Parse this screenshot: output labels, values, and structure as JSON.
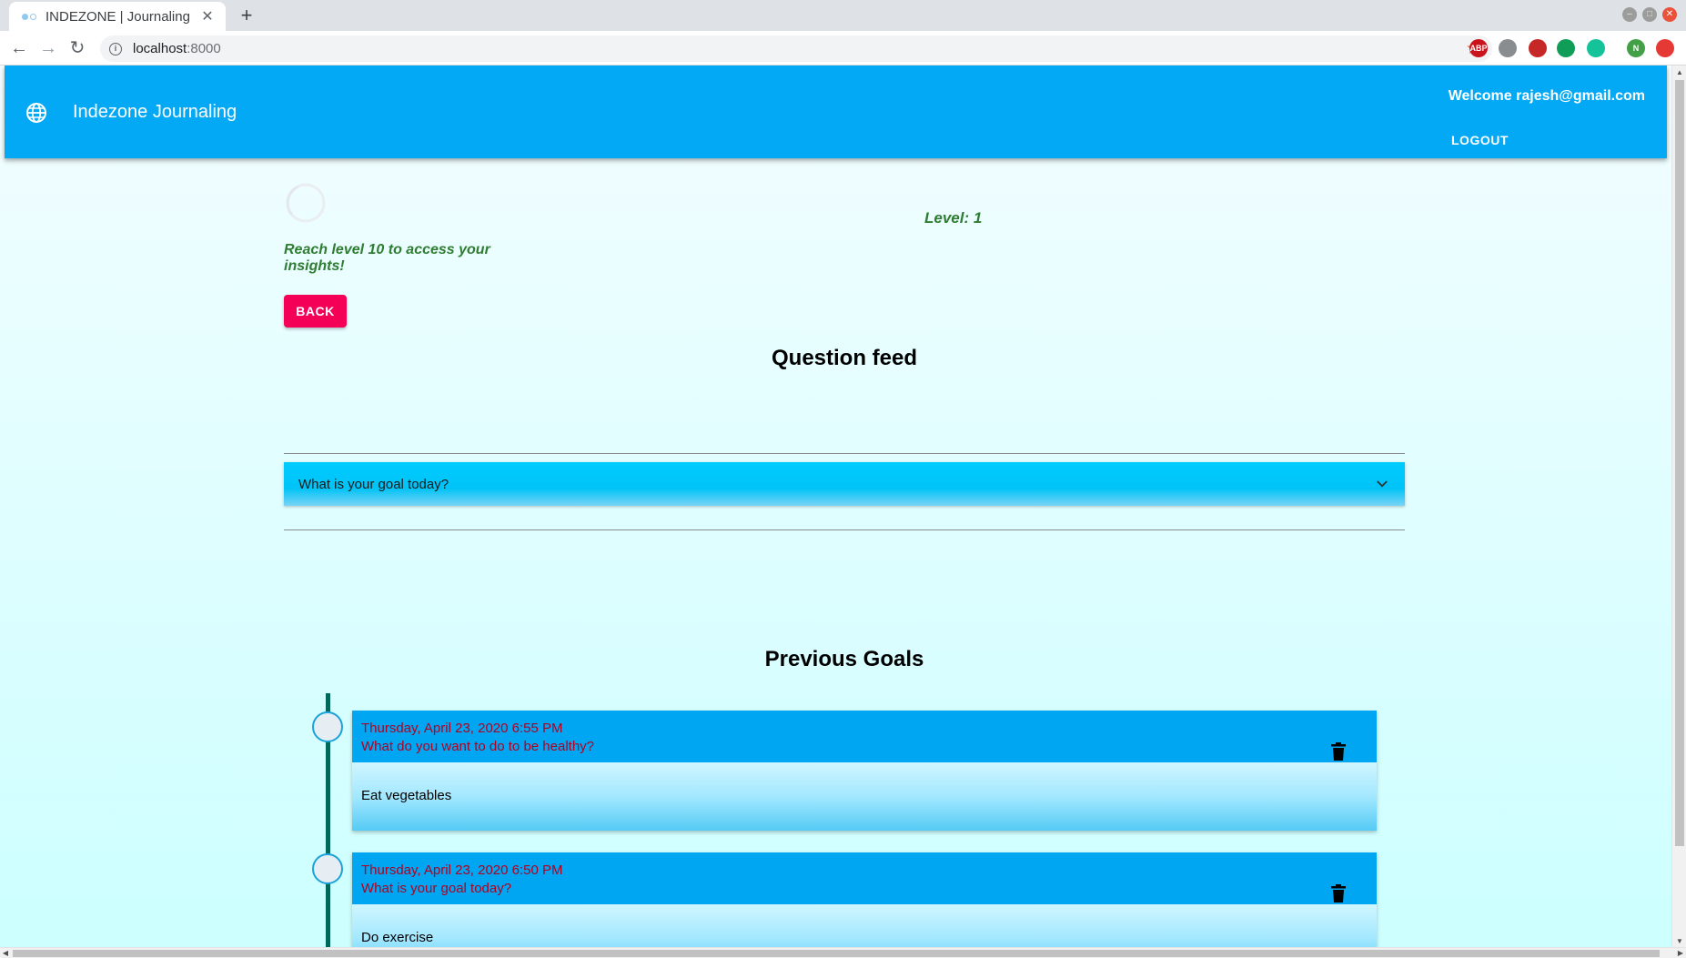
{
  "browser": {
    "tab_title": "INDEZONE | Journaling",
    "tab_close": "✕",
    "new_tab": "+",
    "url_host": "localhost",
    "url_port": ":8000",
    "extensions": [
      {
        "name": "adblock-icon",
        "label": "ABP",
        "color": "#c9141c"
      },
      {
        "name": "download-extension-icon",
        "label": "",
        "color": "#8a8d90"
      },
      {
        "name": "screenshot-extension-icon",
        "label": "",
        "color": "#c62828"
      },
      {
        "name": "chat-extension-icon",
        "label": "",
        "color": "#0f9d58"
      },
      {
        "name": "grammarly-icon",
        "label": "",
        "color": "#15c39a"
      },
      {
        "name": "profile-avatar-icon",
        "label": "N",
        "color": "#43a047"
      },
      {
        "name": "power-extension-icon",
        "label": "",
        "color": "#e53935"
      }
    ]
  },
  "header": {
    "app_title": "Indezone Journaling",
    "welcome": "Welcome rajesh@gmail.com",
    "logout": "LOGOUT",
    "accent": "#03a9f4"
  },
  "progress": {
    "level_text": "Level: 1",
    "message": "Reach level 10 to access your insights!",
    "back_label": "BACK",
    "back_color": "#f50057"
  },
  "question_feed": {
    "title": "Question feed",
    "items": [
      {
        "question": "What is your goal today?",
        "expanded": false
      }
    ]
  },
  "previous_goals": {
    "title": "Previous Goals",
    "entries": [
      {
        "date": "Thursday, April 23, 2020 6:55 PM",
        "question": "What do you want to do to be healthy?",
        "answer": "Eat vegetables"
      },
      {
        "date": "Thursday, April 23, 2020 6:50 PM",
        "question": "What is your goal today?",
        "answer": "Do exercise"
      }
    ]
  }
}
